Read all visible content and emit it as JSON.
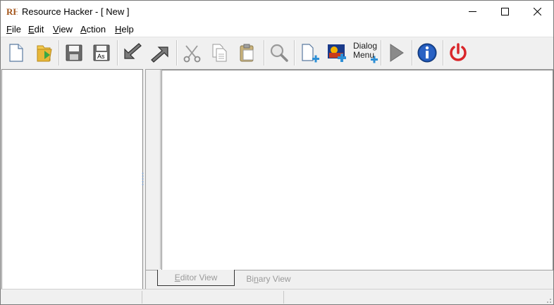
{
  "window": {
    "title": "Resource Hacker - [ New ]",
    "app_icon_text": "RH"
  },
  "menu": [
    {
      "label": "File",
      "mnemonic": "F",
      "rest": "ile"
    },
    {
      "label": "Edit",
      "mnemonic": "E",
      "rest": "dit"
    },
    {
      "label": "View",
      "mnemonic": "V",
      "rest": "iew"
    },
    {
      "label": "Action",
      "mnemonic": "A",
      "rest": "ction"
    },
    {
      "label": "Help",
      "mnemonic": "H",
      "rest": "elp"
    }
  ],
  "toolbar": {
    "icons": [
      "new-file-icon",
      "open-folder-icon",
      "save-icon",
      "save-as-icon",
      "import-arrow-icon",
      "export-arrow-icon",
      "cut-icon",
      "copy-icon",
      "paste-icon",
      "find-icon",
      "add-resource-icon",
      "add-image-icon",
      "dialog-menu-icon",
      "run-script-icon",
      "info-icon",
      "power-icon"
    ],
    "save_as_text": "As",
    "dialog_label_line1": "Dialog",
    "dialog_label_line2": "Menu"
  },
  "tabs": {
    "editor_view": {
      "mnemonic": "E",
      "rest": "ditor View"
    },
    "binary_view": {
      "pre": "Bi",
      "mnemonic": "n",
      "rest": "ary View"
    }
  },
  "colors": {
    "power_red": "#d9262a",
    "info_blue": "#1a4fa8",
    "add_plus_blue": "#2d8fd6"
  }
}
